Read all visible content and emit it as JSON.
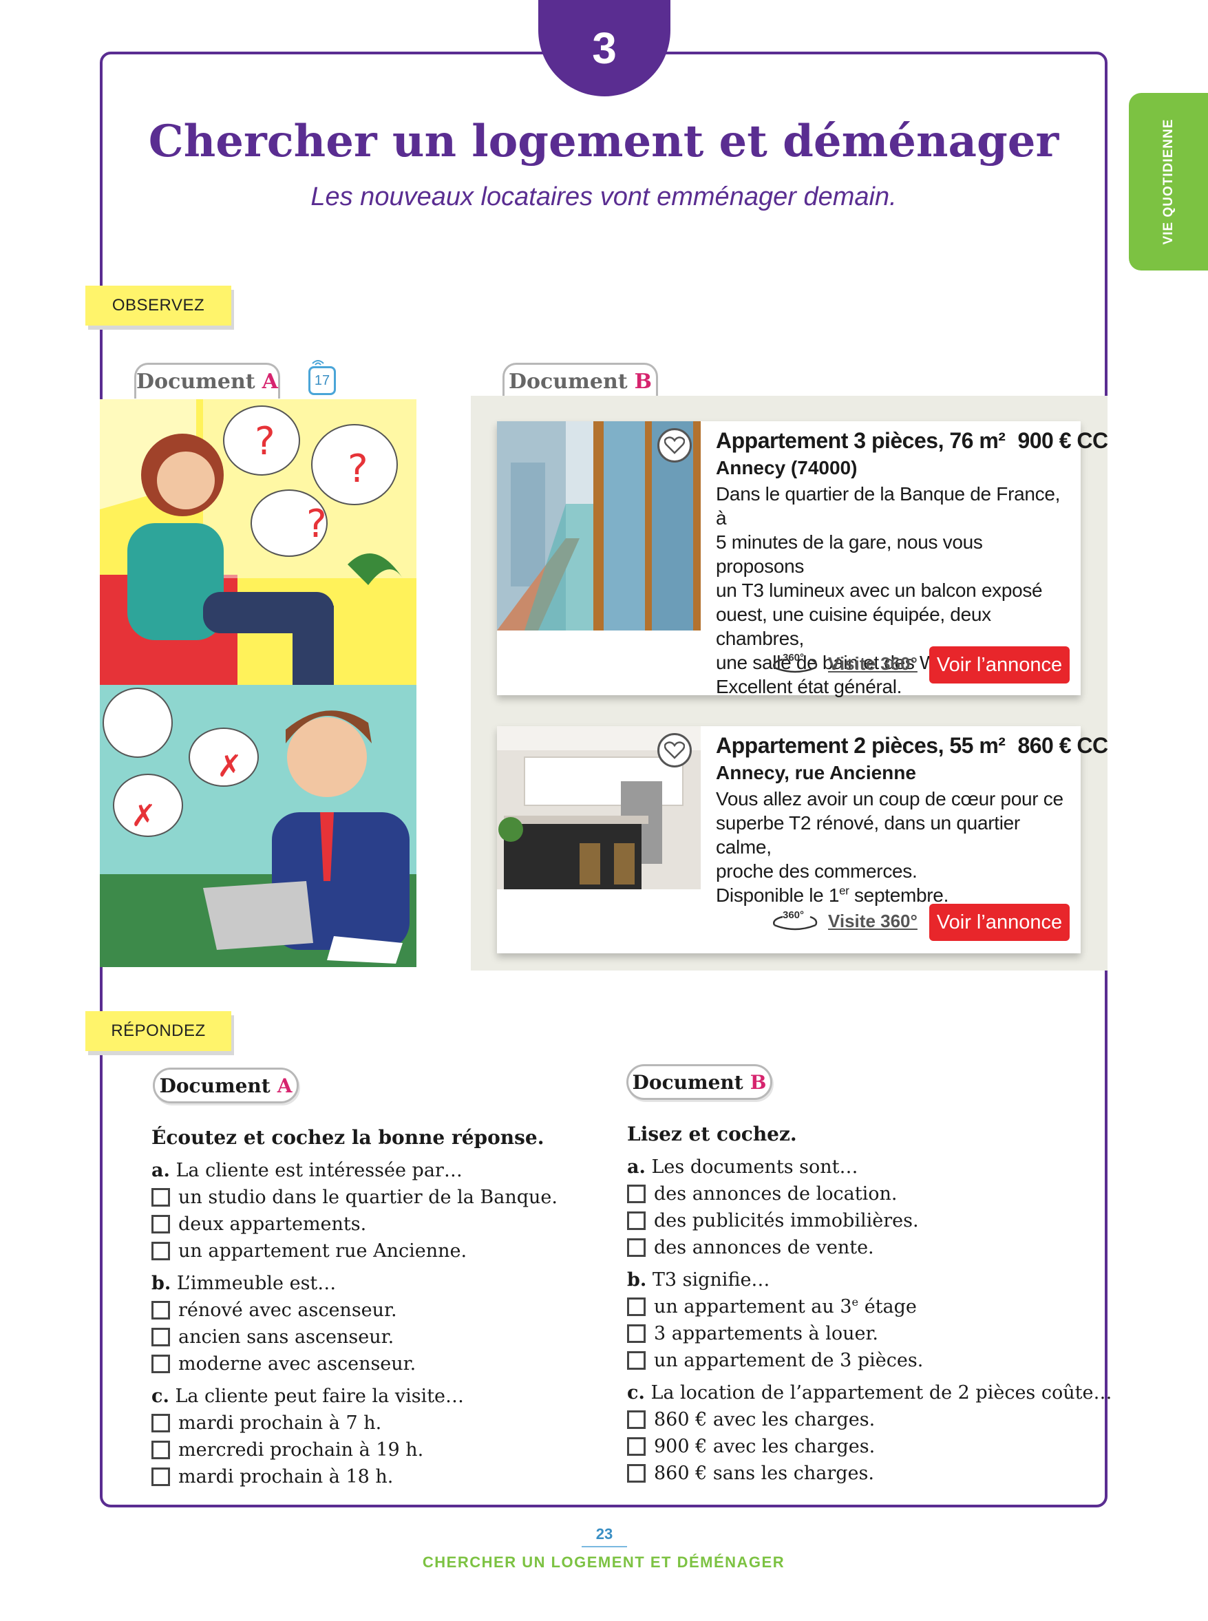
{
  "unit_number": "3",
  "side_tab": "VIE QUOTIDIENNE",
  "title": "Chercher un logement et déménager",
  "subtitle": "Les nouveaux locataires vont emménager demain.",
  "sections": {
    "observe": "OBSERVEZ",
    "answer": "RÉPONDEZ"
  },
  "doc_label": "Document",
  "doc_a_letter": "A",
  "doc_b_letter": "B",
  "audio_track": "17",
  "doc_b": {
    "listings": [
      {
        "head": "Appartement 3 pièces, 76 m²",
        "price": "900 € CC",
        "location": "Annecy (74000)",
        "desc": [
          "Dans le quartier de la Banque de France, à",
          "5 minutes de la gare, nous vous proposons",
          "un T3 lumineux avec un balcon exposé",
          "ouest, une cuisine équipée, deux chambres,",
          "une salle de bain et des WC séparés.",
          "Excellent état général."
        ],
        "visit_icon": "360°",
        "visit_label": "Visite 360°",
        "button": "Voir l’annonce"
      },
      {
        "head": "Appartement 2 pièces, 55 m²",
        "price": "860 € CC",
        "location": "Annecy, rue Ancienne",
        "desc": [
          "Vous allez avoir un coup de cœur pour ce",
          "superbe T2 rénové, dans un quartier calme,",
          "proche des commerces."
        ],
        "desc_last_pre": "Disponible le 1",
        "desc_last_sup": "er",
        "desc_last_post": " septembre.",
        "visit_icon": "360°",
        "visit_label": "Visite 360°",
        "button": "Voir l’annonce"
      }
    ]
  },
  "exercise_a": {
    "instruction": "Écoutez et cochez la bonne réponse.",
    "questions": [
      {
        "letter": "a.",
        "text": "La cliente est intéressée par…",
        "options": [
          "un studio dans le quartier de la Banque.",
          "deux appartements.",
          "un appartement rue Ancienne."
        ]
      },
      {
        "letter": "b.",
        "text": "L’immeuble est…",
        "options": [
          "rénové avec ascenseur.",
          "ancien sans ascenseur.",
          "moderne avec ascenseur."
        ]
      },
      {
        "letter": "c.",
        "text": "La cliente peut faire la visite…",
        "options": [
          "mardi prochain à 7 h.",
          "mercredi prochain à 19 h.",
          "mardi prochain à 18 h."
        ]
      }
    ]
  },
  "exercise_b": {
    "instruction": "Lisez et cochez.",
    "q1": {
      "letter": "a.",
      "text": "Les documents sont…",
      "options": [
        "des annonces de location.",
        "des publicités immobilières.",
        "des annonces de vente."
      ]
    },
    "q2": {
      "letter": "b.",
      "text": "T3 signifie…",
      "opt1_pre": "un appartement au 3",
      "opt1_sup": "e",
      "opt1_post": " étage",
      "options": [
        "3 appartements à louer.",
        "un appartement de 3 pièces."
      ]
    },
    "q3": {
      "letter": "c.",
      "text": "La location de l’appartement de 2 pièces coûte…",
      "options": [
        "860 € avec les charges.",
        "900 € avec les charges.",
        "860 € sans les charges."
      ]
    }
  },
  "page_number": "23",
  "footer": "CHERCHER UN LOGEMENT ET DÉMÉNAGER",
  "colors": {
    "purple": "#5a2d91",
    "green": "#7cc242",
    "red_button": "#e8262b",
    "magenta": "#d6246e",
    "yellow": "#fff46b"
  }
}
